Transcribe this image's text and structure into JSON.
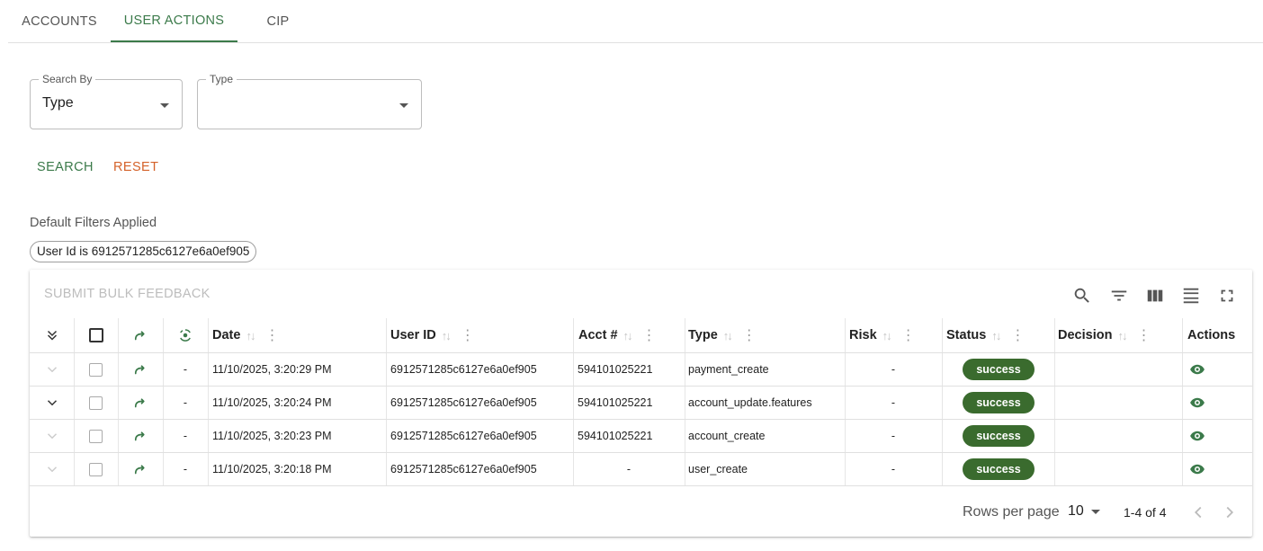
{
  "tabs": [
    {
      "label": "ACCOUNTS"
    },
    {
      "label": "USER ACTIONS"
    },
    {
      "label": "CIP"
    }
  ],
  "search": {
    "search_by_label": "Search By",
    "search_by_value": "Type",
    "type_label": "Type",
    "type_value": "",
    "search_button": "SEARCH",
    "reset_button": "RESET"
  },
  "filters": {
    "label": "Default Filters Applied",
    "chip": "User Id is 6912571285c6127e6a0ef905"
  },
  "toolbar": {
    "bulk_feedback": "SUBMIT BULK FEEDBACK",
    "icons": [
      "search-icon",
      "filter-icon",
      "columns-icon",
      "density-icon",
      "fullscreen-icon"
    ]
  },
  "table": {
    "columns": {
      "date": "Date",
      "user_id": "User ID",
      "acct": "Acct #",
      "type": "Type",
      "risk": "Risk",
      "status": "Status",
      "decision": "Decision",
      "actions": "Actions"
    },
    "rows": [
      {
        "dash": "-",
        "date": "11/10/2025, 3:20:29 PM",
        "user_id": "6912571285c6127e6a0ef905",
        "acct": "594101025221",
        "type": "payment_create",
        "risk": "-",
        "status": "success",
        "decision": ""
      },
      {
        "dash": "-",
        "date": "11/10/2025, 3:20:24 PM",
        "user_id": "6912571285c6127e6a0ef905",
        "acct": "594101025221",
        "type": "account_update.features",
        "risk": "-",
        "status": "success",
        "decision": ""
      },
      {
        "dash": "-",
        "date": "11/10/2025, 3:20:23 PM",
        "user_id": "6912571285c6127e6a0ef905",
        "acct": "594101025221",
        "type": "account_create",
        "risk": "-",
        "status": "success",
        "decision": ""
      },
      {
        "dash": "-",
        "date": "11/10/2025, 3:20:18 PM",
        "user_id": "6912571285c6127e6a0ef905",
        "acct": "-",
        "type": "user_create",
        "risk": "-",
        "status": "success",
        "decision": ""
      }
    ]
  },
  "pagination": {
    "rows_per_page_label": "Rows per page",
    "rows_per_page": "10",
    "range": "1-4 of 4"
  },
  "colors": {
    "accent": "#3b7a4a",
    "reset": "#d4622a",
    "badge": "#3a6b2e"
  }
}
